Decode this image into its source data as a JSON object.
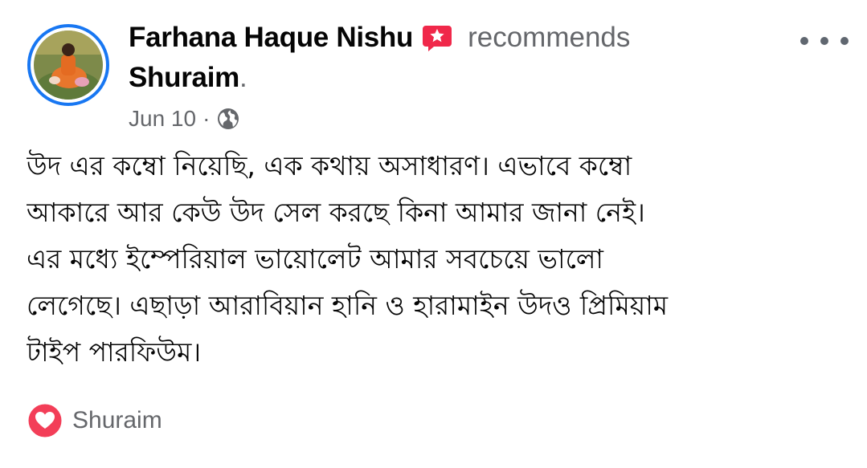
{
  "post": {
    "author": "Farhana Haque Nishu",
    "recommend_icon": "recommend-star-icon",
    "action_text": "recommends",
    "page": "Shuraim",
    "period": ".",
    "date": "Jun 10",
    "separator": "·",
    "audience_icon": "globe-icon",
    "more_icon": "more-options-icon",
    "body_lines": [
      "উদ এর কম্বো নিয়েছি, এক কথায় অসাধারণ। এভাবে কম্বো",
      "আকারে আর কেউ উদ সেল করছে কিনা আমার জানা নেই।",
      "এর মধ্যে ইম্পেরিয়াল ভায়োলেট আমার সবচেয়ে ভালো",
      "লেগেছে। এছাড়া আরাবিয়ান হানি ও হারামাইন উদও প্রিমিয়াম",
      "টাইপ পারফিউম।"
    ],
    "reaction": {
      "icon": "love-reaction-icon",
      "name": "Shuraim"
    }
  },
  "colors": {
    "avatar_ring": "#1877f2",
    "recommend_badge": "#f0284a",
    "secondary_text": "#65676b",
    "primary_text": "#050505",
    "love_reaction": "#f33e58"
  }
}
